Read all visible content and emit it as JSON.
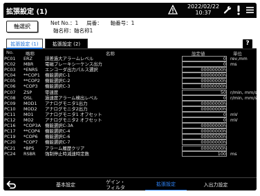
{
  "titlebar": {
    "title": "拡張設定 (1)",
    "date": "2022/02/22",
    "time": "10:37"
  },
  "header": {
    "axis_button": "軸選択",
    "net_no": "Net No.：1",
    "station": "局番：",
    "axis_no": "軸番号：1",
    "axis_name": "軸名称：軸名称1"
  },
  "tabs": {
    "tab1": "拡張設定 (1)",
    "tab2": "拡張設定 (2)",
    "help": "?"
  },
  "columns": {
    "no": "No.",
    "abbr": "略称",
    "name": "名称",
    "value": "設定値",
    "unit": "単位"
  },
  "rows": [
    {
      "no": "PC01",
      "abbr": "ERZ",
      "name": "誤差過大アラームレベル",
      "value": "0",
      "unit": "rev,mm"
    },
    {
      "no": "PC02",
      "abbr": "MBR",
      "name": "電磁ブレーキシーケンス出力",
      "value": "0",
      "unit": "ms"
    },
    {
      "no": "PC03",
      "abbr": "*ENRS",
      "name": "エンコーダ出力パルス選択",
      "value": "00000000h",
      "unit": ""
    },
    {
      "no": "PC04",
      "abbr": "**COP1",
      "name": "機能選択C-1",
      "value": "00000000h",
      "unit": ""
    },
    {
      "no": "PC05",
      "abbr": "**COP2",
      "name": "機能選択C-2",
      "value": "00000000h",
      "unit": ""
    },
    {
      "no": "PC06",
      "abbr": "*COP3",
      "name": "機能選択C-3",
      "value": "00000000h",
      "unit": ""
    },
    {
      "no": "PC07",
      "abbr": "ZSP",
      "name": "零速度",
      "value": "50",
      "unit": "r/min, mm/s"
    },
    {
      "no": "PC08",
      "abbr": "OSL",
      "name": "過速度アラーム検出レベル",
      "value": "0",
      "unit": "r/min, mm/s"
    },
    {
      "no": "PC09",
      "abbr": "MOD1",
      "name": "アナログモニタ1出力",
      "value": "00000000h",
      "unit": ""
    },
    {
      "no": "PC10",
      "abbr": "MOD2",
      "name": "アナログモニタ2出力",
      "value": "00000000h",
      "unit": ""
    },
    {
      "no": "PC11",
      "abbr": "MO1",
      "name": "アナログモニタ1 オフセット",
      "value": "0",
      "unit": "mV"
    },
    {
      "no": "PC12",
      "abbr": "MO2",
      "name": "アナログモニタ2 オフセット",
      "value": "0",
      "unit": "mV"
    },
    {
      "no": "PC16",
      "abbr": "*COP3A",
      "name": "機能選択C-3A",
      "value": "00000000h",
      "unit": ""
    },
    {
      "no": "PC17",
      "abbr": "**COP4",
      "name": "機能選択C-4",
      "value": "00000000h",
      "unit": ""
    },
    {
      "no": "PC19",
      "abbr": "*COP6",
      "name": "機能選択C-6",
      "value": "00000000h",
      "unit": ""
    },
    {
      "no": "PC20",
      "abbr": "*COP7",
      "name": "機能選択C-7",
      "value": "00000000h",
      "unit": ""
    },
    {
      "no": "PC21",
      "abbr": "*BPS",
      "name": "アラーム履歴クリア",
      "value": "00000000h",
      "unit": ""
    },
    {
      "no": "PC24",
      "abbr": "RSBR",
      "name": "強制停止時減速時定数",
      "value": "100",
      "unit": "ms"
    }
  ],
  "bottom_nav": {
    "basic": "基本設定",
    "gain_line1": "ゲイン・",
    "gain_line2": "フィルタ",
    "extended": "拡張設定",
    "io": "入出力設定"
  },
  "icons": {
    "warning": "warning-triangle-icon",
    "wrench": "wrench-icon",
    "exclamation": "exclamation-icon",
    "menu": "menu-icon",
    "back": "back-arrow-icon"
  },
  "colors": {
    "accent": "#1b6fd8",
    "active_nav": "#2f87ff",
    "background": "#000000"
  }
}
